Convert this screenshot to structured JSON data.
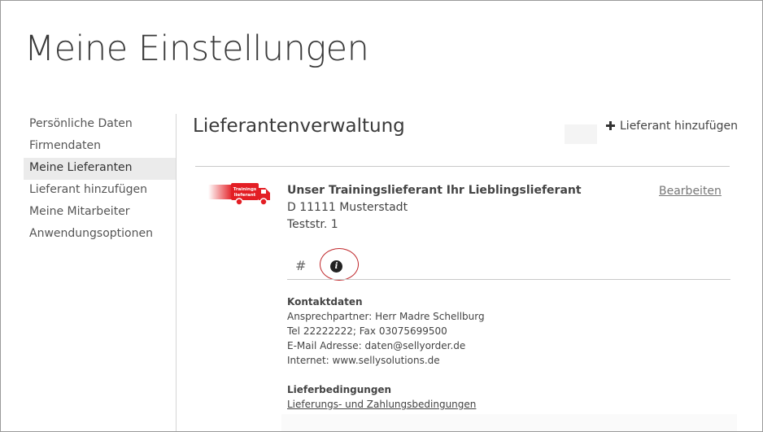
{
  "page": {
    "title": "Meine Einstellungen"
  },
  "sidebar": {
    "items": [
      {
        "label": "Persönliche Daten",
        "active": false
      },
      {
        "label": "Firmendaten",
        "active": false
      },
      {
        "label": "Meine Lieferanten",
        "active": true
      },
      {
        "label": "Lieferant hinzufügen",
        "active": false
      },
      {
        "label": "Meine Mitarbeiter",
        "active": false
      },
      {
        "label": "Anwendungsoptionen",
        "active": false
      }
    ]
  },
  "main": {
    "title": "Lieferantenverwaltung",
    "add_label": "Lieferant hinzufügen"
  },
  "supplier": {
    "logo_text": "Trainings lieferant",
    "name": "Unser Trainingslieferant Ihr Lieblingslieferant",
    "city_line": "D 11111 Musterstadt",
    "street_line": "Teststr. 1",
    "edit_label": "Bearbeiten",
    "accent_color": "#e31e24"
  },
  "tabs": {
    "hash_label": "#",
    "info_icon": "info-icon",
    "info_glyph": "i"
  },
  "contact": {
    "heading": "Kontaktdaten",
    "lines": [
      "Ansprechpartner: Herr Madre Schellburg",
      "Tel 22222222; Fax 03075699500",
      "E-Mail Adresse: daten@sellyorder.de",
      "Internet: www.sellysolutions.de"
    ]
  },
  "delivery": {
    "heading": "Lieferbedingungen",
    "link": "Lieferungs- und Zahlungsbedingungen"
  }
}
